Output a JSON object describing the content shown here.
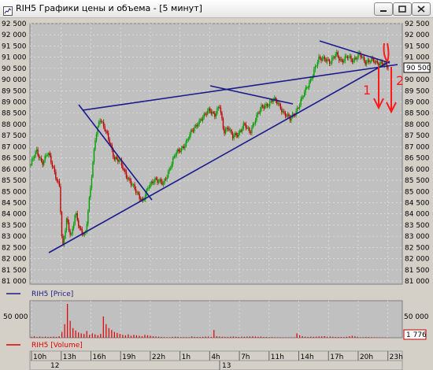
{
  "window": {
    "title": "RIH5 Графики цены и объема - [5 минут]",
    "buttons": [
      "minimize",
      "maximize",
      "close"
    ]
  },
  "legends": {
    "price": "RIH5 [Price]",
    "volume": "RIH5 [Volume]",
    "price_color": "#1c1c80",
    "volume_color": "#e00000"
  },
  "markers": {
    "last_price": "90 500",
    "last_volume": "1 776"
  },
  "annotations": {
    "mark1": "1",
    "mark2": "2"
  },
  "chart_data": [
    {
      "type": "candlestick",
      "series_name": "RIH5 [Price]",
      "y_ticks": [
        "92 500",
        "92 000",
        "91 500",
        "91 000",
        "90 500",
        "90 000",
        "89 500",
        "89 000",
        "88 500",
        "88 000",
        "87 500",
        "87 000",
        "86 500",
        "86 000",
        "85 500",
        "85 000",
        "84 500",
        "84 000",
        "83 500",
        "83 000",
        "82 500",
        "82 000",
        "81 500",
        "81 000"
      ],
      "ylim": [
        81000,
        92500
      ],
      "x_ticks": [
        "10h",
        "13h",
        "16h",
        "19h",
        "22h",
        "1h",
        "4h",
        "7h",
        "11h",
        "14h",
        "17h",
        "20h",
        "23h"
      ],
      "dates": [
        "12",
        "13"
      ],
      "up_color": "#00a000",
      "down_color": "#c00000",
      "approx_path": [
        [
          0,
          86200
        ],
        [
          4,
          86800
        ],
        [
          8,
          86300
        ],
        [
          12,
          86700
        ],
        [
          16,
          86000
        ],
        [
          20,
          85200
        ],
        [
          22,
          82300
        ],
        [
          25,
          83800
        ],
        [
          28,
          83000
        ],
        [
          31,
          84000
        ],
        [
          34,
          83300
        ],
        [
          38,
          83100
        ],
        [
          41,
          84800
        ],
        [
          45,
          87500
        ],
        [
          48,
          88300
        ],
        [
          51,
          87800
        ],
        [
          55,
          87200
        ],
        [
          58,
          86500
        ],
        [
          62,
          86300
        ],
        [
          66,
          85800
        ],
        [
          70,
          85300
        ],
        [
          74,
          84900
        ],
        [
          78,
          84600
        ],
        [
          82,
          85200
        ],
        [
          86,
          85600
        ],
        [
          92,
          85300
        ],
        [
          96,
          86000
        ],
        [
          100,
          86600
        ],
        [
          104,
          86900
        ],
        [
          108,
          87200
        ],
        [
          112,
          87700
        ],
        [
          116,
          88100
        ],
        [
          120,
          88300
        ],
        [
          124,
          88700
        ],
        [
          128,
          88400
        ],
        [
          131,
          88800
        ],
        [
          134,
          87700
        ],
        [
          137,
          87900
        ],
        [
          140,
          87400
        ],
        [
          144,
          87600
        ],
        [
          148,
          88000
        ],
        [
          152,
          87600
        ],
        [
          156,
          88300
        ],
        [
          160,
          88700
        ],
        [
          164,
          88900
        ],
        [
          168,
          89100
        ],
        [
          172,
          88900
        ],
        [
          176,
          88500
        ],
        [
          180,
          88200
        ],
        [
          184,
          88600
        ],
        [
          188,
          89100
        ],
        [
          192,
          89700
        ],
        [
          196,
          90300
        ],
        [
          200,
          90900
        ],
        [
          204,
          91000
        ],
        [
          208,
          90700
        ],
        [
          212,
          91200
        ],
        [
          216,
          90800
        ],
        [
          220,
          91000
        ],
        [
          224,
          90900
        ],
        [
          228,
          91100
        ],
        [
          232,
          90800
        ],
        [
          236,
          90900
        ],
        [
          240,
          90700
        ],
        [
          244,
          90800
        ],
        [
          248,
          90500
        ]
      ]
    },
    {
      "type": "bar",
      "series_name": "RIH5 [Volume]",
      "y_ticks": [
        "50 000"
      ],
      "ylim": [
        0,
        70000
      ],
      "color": "#e00000",
      "values": [
        2000,
        3000,
        1500,
        2500,
        1800,
        2200,
        1600,
        2000,
        2400,
        1700,
        3000,
        12000,
        28000,
        70000,
        35000,
        20000,
        15000,
        11000,
        9000,
        8000,
        14000,
        6000,
        9000,
        7000,
        5000,
        8000,
        44000,
        28000,
        20000,
        16000,
        12000,
        10000,
        8000,
        6000,
        5000,
        7000,
        4000,
        6000,
        5000,
        4000,
        3000,
        6000,
        5000,
        4000,
        3000,
        2500,
        2000,
        1500,
        1200,
        1000,
        900,
        1500,
        2000,
        1800,
        1500,
        1300,
        1200,
        1100,
        2500,
        1800,
        1500,
        1400,
        1800,
        2200,
        2500,
        1800,
        16000,
        3000,
        2500,
        2000,
        1800,
        1500,
        2000,
        2500,
        2000,
        1800,
        2200,
        1900,
        2400,
        2600,
        2800,
        2400,
        1800,
        2200,
        1600,
        1500,
        1300,
        1200,
        1000,
        800,
        600,
        400,
        800,
        700,
        600,
        500,
        9000,
        5000,
        3000,
        2000,
        1800,
        2000,
        1900,
        2100,
        2600,
        2800,
        3200,
        2000,
        2500,
        2000,
        1700,
        1600,
        1500,
        1400,
        2000,
        3000,
        4000,
        3000,
        2000,
        1000,
        1200,
        1400,
        1300,
        1100,
        900,
        800,
        700,
        600,
        500,
        400
      ]
    }
  ]
}
